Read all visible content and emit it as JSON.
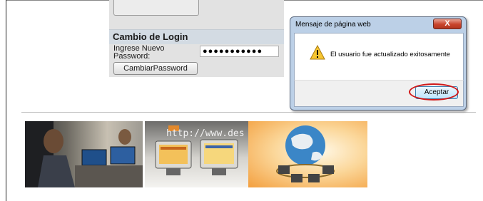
{
  "login": {
    "title": "Cambio de Login",
    "password_label": "Ingrese Nuevo Password:",
    "password_value": "●●●●●●●●●●●",
    "change_button": "CambiarPassword"
  },
  "dialog": {
    "title": "Mensaje de página web",
    "close_label": "X",
    "message": "El usuario fue actualizado exitosamente",
    "ok_button": "Aceptar"
  },
  "banner": {
    "web_url_text": "http://www.des",
    "accent_color": "#e3892c"
  },
  "colors": {
    "highlight_circle": "#d01818",
    "dialog_frame": "#bcd0e7",
    "login_header": "#d3dbe3"
  }
}
